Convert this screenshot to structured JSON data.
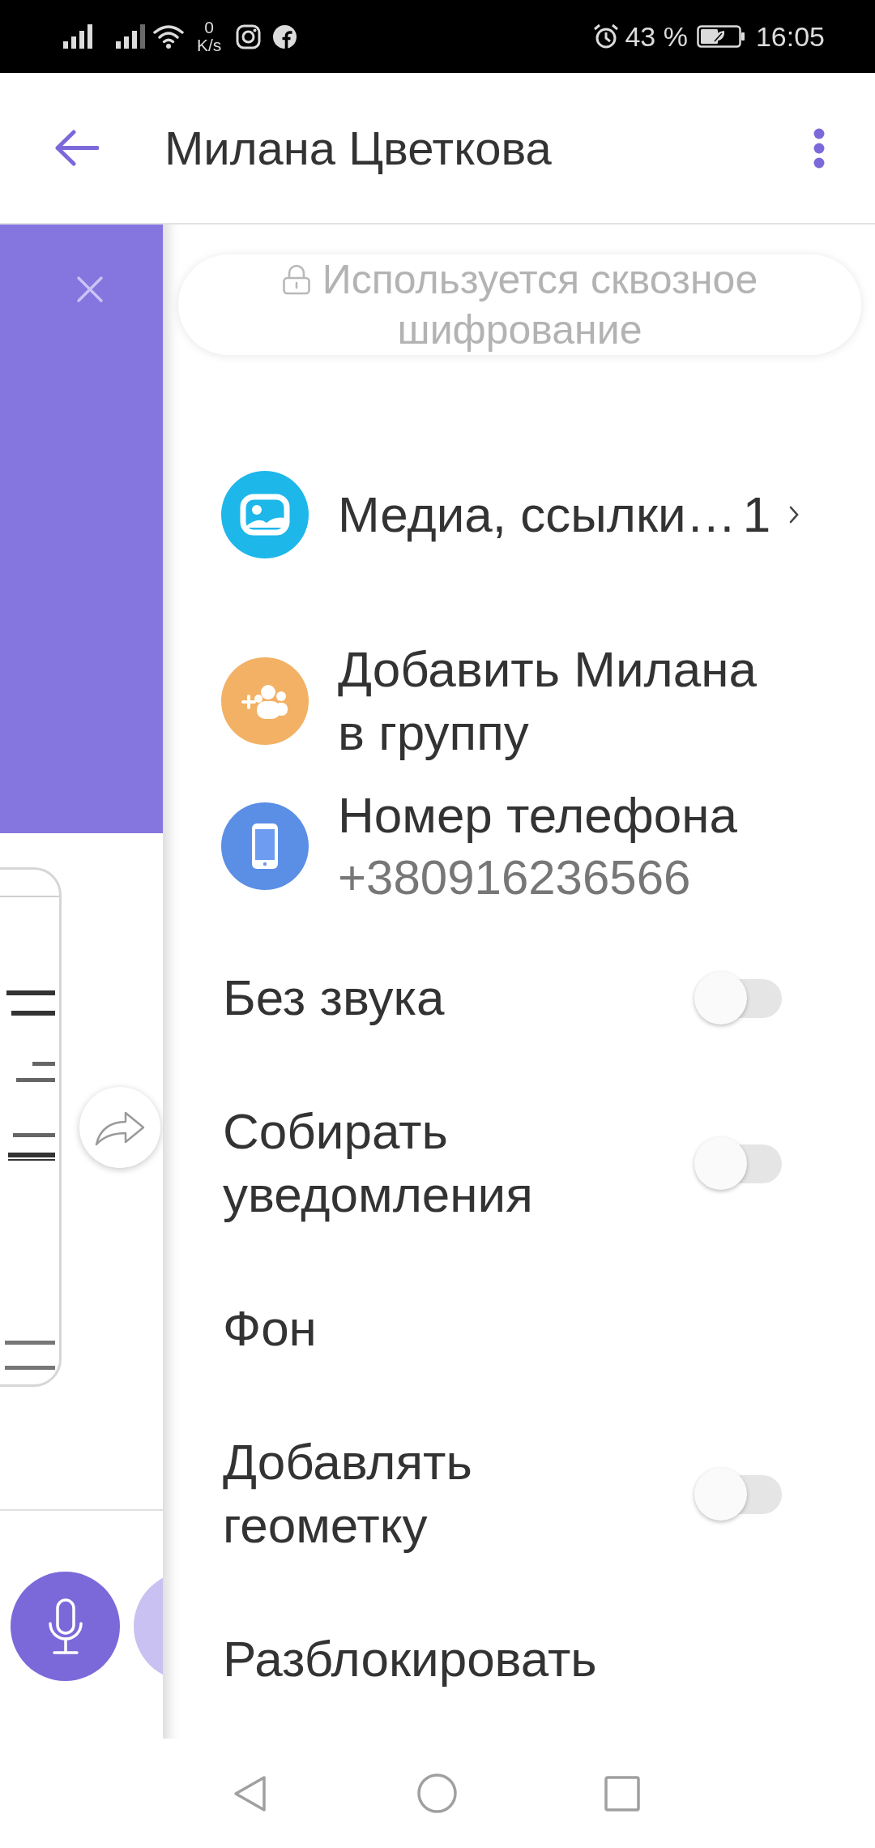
{
  "status_bar": {
    "speed_value": "0",
    "speed_unit": "K/s",
    "battery": "43 %",
    "time": "16:05"
  },
  "header": {
    "title": "Милана Цветкова"
  },
  "encryption_notice": "Используется сквозное шифрование",
  "media": {
    "label": "Медиа, ссылки…",
    "count": "1"
  },
  "actions": [
    {
      "kind": "group",
      "label": "Добавить Милана в группу"
    },
    {
      "kind": "phone",
      "label": "Номер телефона",
      "value": "+380916236566"
    }
  ],
  "settings": [
    {
      "kind": "toggle",
      "label": "Без звука",
      "on": false
    },
    {
      "kind": "toggle",
      "label": "Собирать уведомления",
      "on": false
    },
    {
      "kind": "link",
      "label": "Фон"
    },
    {
      "kind": "toggle",
      "label": "Добавлять геометку",
      "on": false
    },
    {
      "kind": "link",
      "label": "Разблокировать"
    }
  ]
}
